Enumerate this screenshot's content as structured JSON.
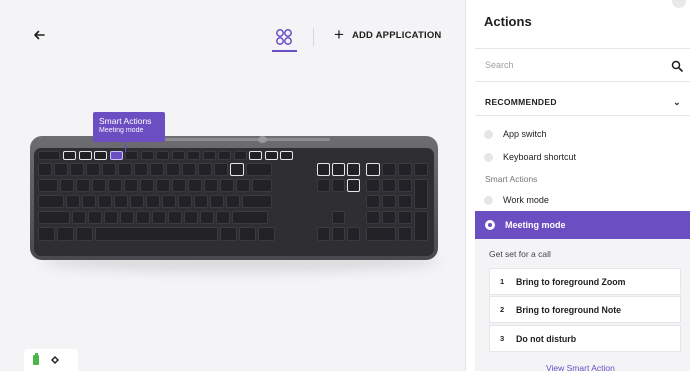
{
  "toolbar": {
    "add_application_label": "ADD APPLICATION"
  },
  "tooltip": {
    "title": "Smart Actions",
    "subtitle": "Meeting mode"
  },
  "panel": {
    "title": "Actions",
    "search_placeholder": "Search",
    "recommended_label": "RECOMMENDED",
    "items": [
      {
        "label": "App switch"
      },
      {
        "label": "Keyboard shortcut"
      }
    ],
    "smart_actions_label": "Smart Actions",
    "smart_items": [
      {
        "label": "Work mode"
      },
      {
        "label": "Meeting mode"
      }
    ],
    "detail": {
      "label": "Get set for a call",
      "steps": [
        {
          "num": "1",
          "label": "Bring to foreground Zoom"
        },
        {
          "num": "2",
          "label": "Bring to foreground Note"
        },
        {
          "num": "3",
          "label": "Do not disturb"
        }
      ],
      "view_link": "View Smart Action"
    }
  },
  "colors": {
    "accent": "#6b4ec2",
    "battery": "#4cb64a"
  },
  "icons": [
    "back-arrow-icon",
    "grid-view-icon",
    "plus-icon",
    "search-icon",
    "chevron-down-icon",
    "battery-icon",
    "logi-flow-icon"
  ]
}
